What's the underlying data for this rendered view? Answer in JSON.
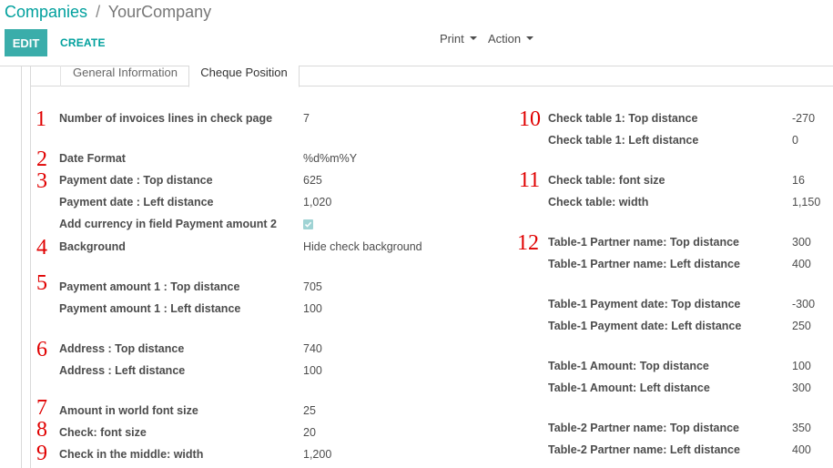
{
  "breadcrumb": {
    "parent": "Companies",
    "separator": "/",
    "current": "YourCompany"
  },
  "buttons": {
    "edit": "EDIT",
    "create": "CREATE"
  },
  "toolbar": {
    "print": "Print",
    "action": "Action"
  },
  "tabs": [
    {
      "label": "General Information"
    },
    {
      "label": "Cheque Position"
    }
  ],
  "markers": [
    "1",
    "2",
    "3",
    "4",
    "5",
    "6",
    "7",
    "8",
    "9",
    "10",
    "11",
    "12"
  ],
  "left": [
    {
      "label": "Number of invoices lines in check page",
      "value": "7"
    },
    {
      "label": "Date Format",
      "value": "%d%m%Y"
    },
    {
      "label": "Payment date : Top distance",
      "value": "625"
    },
    {
      "label": "Payment date : Left distance",
      "value": "1,020"
    },
    {
      "label": "Add currency in field Payment amount 2",
      "value": "checked"
    },
    {
      "label": "Background",
      "value": "Hide check background"
    },
    {
      "label": "Payment amount 1 : Top distance",
      "value": "705"
    },
    {
      "label": "Payment amount 1 : Left distance",
      "value": "100"
    },
    {
      "label": "Address : Top distance",
      "value": "740"
    },
    {
      "label": "Address : Left distance",
      "value": "100"
    },
    {
      "label": "Amount in world font size",
      "value": "25"
    },
    {
      "label": "Check: font size",
      "value": "20"
    },
    {
      "label": "Check in the middle: width",
      "value": "1,200"
    }
  ],
  "right": [
    {
      "label": "Check table 1: Top distance",
      "value": "-270"
    },
    {
      "label": "Check table 1: Left distance",
      "value": "0"
    },
    {
      "label": "Check table: font size",
      "value": "16"
    },
    {
      "label": "Check table: width",
      "value": "1,150"
    },
    {
      "label": "Table-1 Partner name: Top distance",
      "value": "300"
    },
    {
      "label": "Table-1 Partner name: Left distance",
      "value": "400"
    },
    {
      "label": "Table-1 Payment date: Top distance",
      "value": "-300"
    },
    {
      "label": "Table-1 Payment date: Left distance",
      "value": "250"
    },
    {
      "label": "Table-1 Amount: Top distance",
      "value": "100"
    },
    {
      "label": "Table-1 Amount: Left distance",
      "value": "300"
    },
    {
      "label": "Table-2 Partner name: Top distance",
      "value": "350"
    },
    {
      "label": "Table-2 Partner name: Left distance",
      "value": "400"
    }
  ],
  "colors": {
    "accent": "#00a09d",
    "edit_button": "#3aadaa",
    "marker": "#e00000",
    "checkbox": "#9fd3d4"
  }
}
